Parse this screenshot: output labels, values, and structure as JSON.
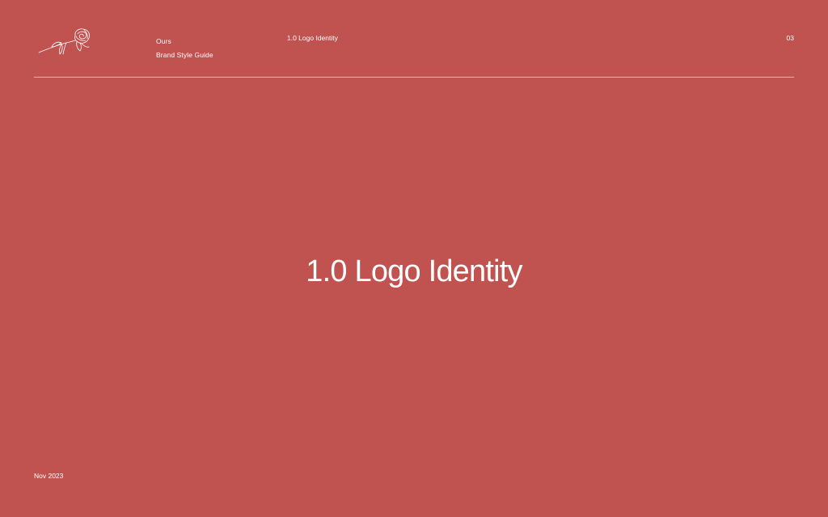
{
  "header": {
    "brand_name": "Ours",
    "brand_subtitle": "Brand Style Guide",
    "section_label": "1.0 Logo Identity",
    "page_number": "03"
  },
  "main": {
    "title": "1.0 Logo Identity"
  },
  "footer": {
    "date": "Nov 2023"
  },
  "colors": {
    "background": "#c05250",
    "foreground": "#ffffff"
  },
  "icons": {
    "logo": "rose-line-art-icon"
  }
}
